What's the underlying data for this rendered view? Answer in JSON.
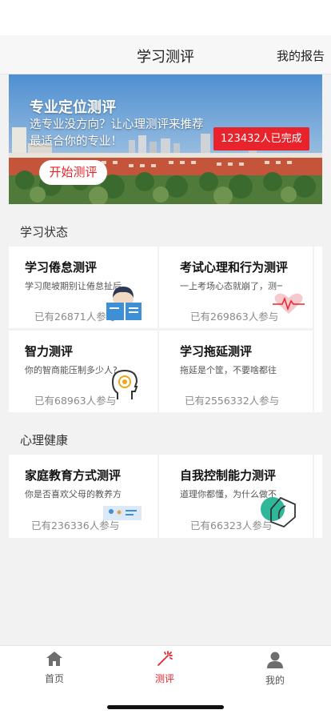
{
  "header": {
    "title": "学习测评",
    "report_label": "我的报告"
  },
  "banner": {
    "title": "专业定位测评",
    "subtitle": "选专业没方向？让心理测评来推荐最适合你的专业！",
    "count": "123432人已完成",
    "start_label": "开始测评"
  },
  "sections": [
    {
      "title": "学习状态",
      "cards": [
        {
          "title": "学习倦怠测评",
          "desc": "学习爬坡期别让倦怠扯后",
          "count": "已有26871人参与"
        },
        {
          "title": "考试心理和行为测评",
          "desc": "一上考场心态就崩了，测一",
          "count": "已有269863人参与"
        },
        {
          "title": "智力测评",
          "desc": "你的智商能压制多少人?",
          "count": "已有68963人参与"
        },
        {
          "title": "学习拖延测评",
          "desc": "拖延是个筐，不要啥都往",
          "count": "已有2556332人参与"
        }
      ]
    },
    {
      "title": "心理健康",
      "cards": [
        {
          "title": "家庭教育方式测评",
          "desc": "你是否喜欢父母的教养方",
          "count": "已有236336人参与"
        },
        {
          "title": "自我控制能力测评",
          "desc": "道理你都懂，为什么做不",
          "count": "已有66323人参与"
        }
      ]
    }
  ],
  "tabs": [
    {
      "label": "首页",
      "icon": "home-icon"
    },
    {
      "label": "测评",
      "icon": "assessment-icon"
    },
    {
      "label": "我的",
      "icon": "profile-icon"
    }
  ],
  "colors": {
    "accent": "#e8232b",
    "page_bg": "#f2f2f2",
    "muted": "#8a8a8a"
  }
}
